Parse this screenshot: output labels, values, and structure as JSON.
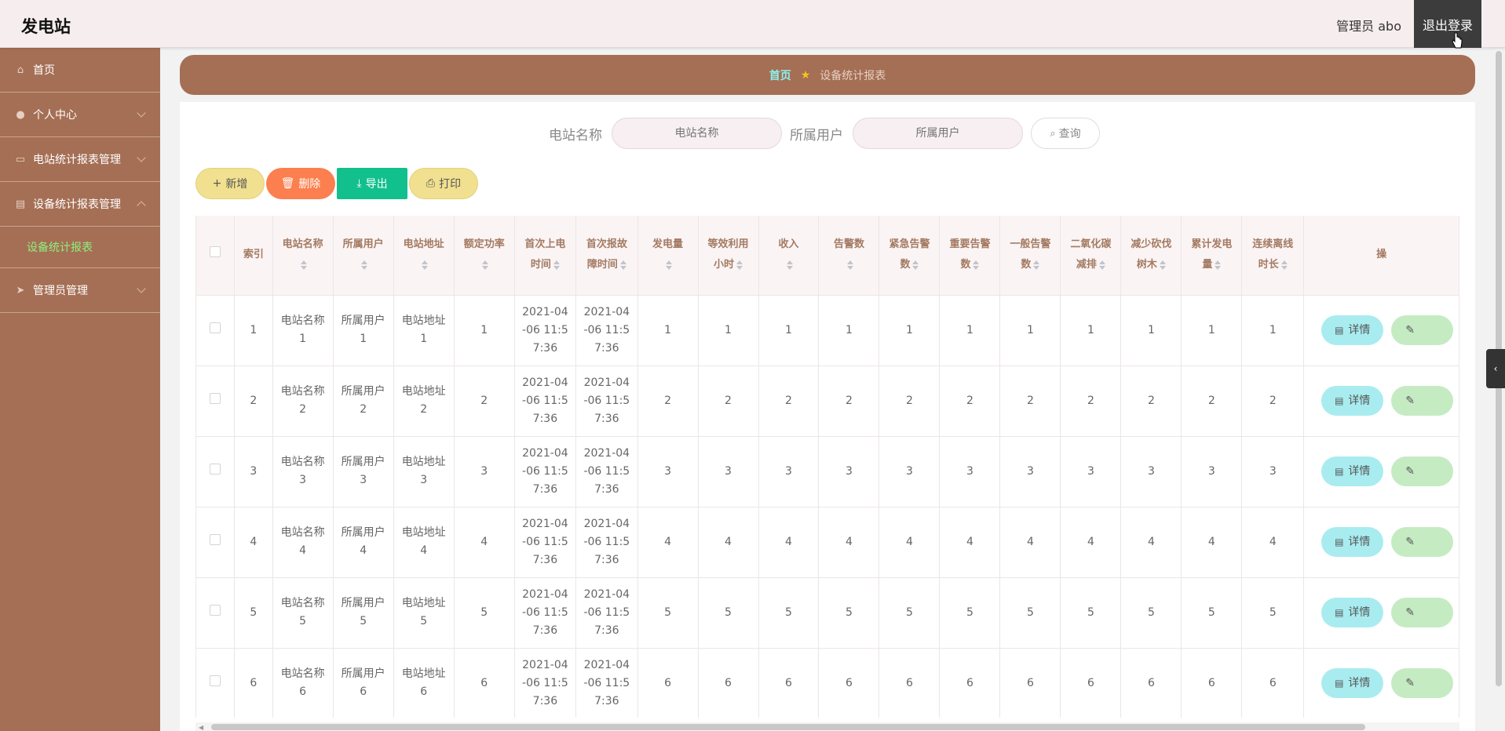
{
  "header": {
    "brand": "发电站",
    "admin_label": "管理员 abo",
    "logout_label": "退出登录"
  },
  "sidebar": {
    "items": [
      {
        "label": "首页",
        "icon": "home-icon"
      },
      {
        "label": "个人中心",
        "icon": "user-icon"
      },
      {
        "label": "电站统计报表管理",
        "icon": "report-icon"
      },
      {
        "label": "设备统计报表管理",
        "icon": "clipboard-icon"
      },
      {
        "label": "管理员管理",
        "icon": "send-icon"
      }
    ],
    "active_sub": "设备统计报表"
  },
  "breadcrumb": {
    "home": "首页",
    "current": "设备统计报表"
  },
  "search": {
    "station_label": "电站名称",
    "station_placeholder": "电站名称",
    "user_label": "所属用户",
    "user_placeholder": "所属用户",
    "query_label": "查询"
  },
  "actions": {
    "add": "新增",
    "delete": "删除",
    "export": "导出",
    "print": "打印"
  },
  "colors": {
    "sidebar": "#a56f55",
    "active_sub": "#8ff07c",
    "add": "#f0e08f",
    "delete": "#fb7f4f",
    "export": "#12c08e",
    "detail": "#a8ecf0"
  },
  "table": {
    "headers": [
      {
        "line1": "索引",
        "line2": ""
      },
      {
        "line1": "电站名称",
        "line2": ""
      },
      {
        "line1": "所属用户",
        "line2": ""
      },
      {
        "line1": "电站地址",
        "line2": ""
      },
      {
        "line1": "额定功率",
        "line2": ""
      },
      {
        "line1": "首次上电",
        "line2": "时间"
      },
      {
        "line1": "首次报故",
        "line2": "障时间"
      },
      {
        "line1": "发电量",
        "line2": ""
      },
      {
        "line1": "等效利用",
        "line2": "小时"
      },
      {
        "line1": "收入",
        "line2": ""
      },
      {
        "line1": "告警数",
        "line2": ""
      },
      {
        "line1": "紧急告警",
        "line2": "数"
      },
      {
        "line1": "重要告警",
        "line2": "数"
      },
      {
        "line1": "一般告警",
        "line2": "数"
      },
      {
        "line1": "二氧化碳",
        "line2": "减排"
      },
      {
        "line1": "减少砍伐",
        "line2": "树木"
      },
      {
        "line1": "累计发电",
        "line2": "量"
      },
      {
        "line1": "连续离线",
        "line2": "时长"
      },
      {
        "line1": "操",
        "line2": ""
      }
    ],
    "detail_label": "详情",
    "rows": [
      {
        "idx": "1",
        "name_a": "电站名称",
        "name_b": "1",
        "user_a": "所属用户",
        "user_b": "1",
        "addr_a": "电站地址",
        "addr_b": "1",
        "power": "1",
        "t1_a": "2021-04",
        "t1_b": "-06 11:5",
        "t1_c": "7:36",
        "t2_a": "2021-04",
        "t2_b": "-06 11:5",
        "t2_c": "7:36",
        "v": [
          "1",
          "1",
          "1",
          "1",
          "1",
          "1",
          "1",
          "1",
          "1",
          "1",
          "1"
        ]
      },
      {
        "idx": "2",
        "name_a": "电站名称",
        "name_b": "2",
        "user_a": "所属用户",
        "user_b": "2",
        "addr_a": "电站地址",
        "addr_b": "2",
        "power": "2",
        "t1_a": "2021-04",
        "t1_b": "-06 11:5",
        "t1_c": "7:36",
        "t2_a": "2021-04",
        "t2_b": "-06 11:5",
        "t2_c": "7:36",
        "v": [
          "2",
          "2",
          "2",
          "2",
          "2",
          "2",
          "2",
          "2",
          "2",
          "2",
          "2"
        ]
      },
      {
        "idx": "3",
        "name_a": "电站名称",
        "name_b": "3",
        "user_a": "所属用户",
        "user_b": "3",
        "addr_a": "电站地址",
        "addr_b": "3",
        "power": "3",
        "t1_a": "2021-04",
        "t1_b": "-06 11:5",
        "t1_c": "7:36",
        "t2_a": "2021-04",
        "t2_b": "-06 11:5",
        "t2_c": "7:36",
        "v": [
          "3",
          "3",
          "3",
          "3",
          "3",
          "3",
          "3",
          "3",
          "3",
          "3",
          "3"
        ]
      },
      {
        "idx": "4",
        "name_a": "电站名称",
        "name_b": "4",
        "user_a": "所属用户",
        "user_b": "4",
        "addr_a": "电站地址",
        "addr_b": "4",
        "power": "4",
        "t1_a": "2021-04",
        "t1_b": "-06 11:5",
        "t1_c": "7:36",
        "t2_a": "2021-04",
        "t2_b": "-06 11:5",
        "t2_c": "7:36",
        "v": [
          "4",
          "4",
          "4",
          "4",
          "4",
          "4",
          "4",
          "4",
          "4",
          "4",
          "4"
        ]
      },
      {
        "idx": "5",
        "name_a": "电站名称",
        "name_b": "5",
        "user_a": "所属用户",
        "user_b": "5",
        "addr_a": "电站地址",
        "addr_b": "5",
        "power": "5",
        "t1_a": "2021-04",
        "t1_b": "-06 11:5",
        "t1_c": "7:36",
        "t2_a": "2021-04",
        "t2_b": "-06 11:5",
        "t2_c": "7:36",
        "v": [
          "5",
          "5",
          "5",
          "5",
          "5",
          "5",
          "5",
          "5",
          "5",
          "5",
          "5"
        ]
      },
      {
        "idx": "6",
        "name_a": "电站名称",
        "name_b": "6",
        "user_a": "所属用户",
        "user_b": "6",
        "addr_a": "电站地址",
        "addr_b": "6",
        "power": "6",
        "t1_a": "2021-04",
        "t1_b": "-06 11:5",
        "t1_c": "7:36",
        "t2_a": "2021-04",
        "t2_b": "-06 11:5",
        "t2_c": "7:36",
        "v": [
          "6",
          "6",
          "6",
          "6",
          "6",
          "6",
          "6",
          "6",
          "6",
          "6",
          "6"
        ]
      }
    ]
  }
}
